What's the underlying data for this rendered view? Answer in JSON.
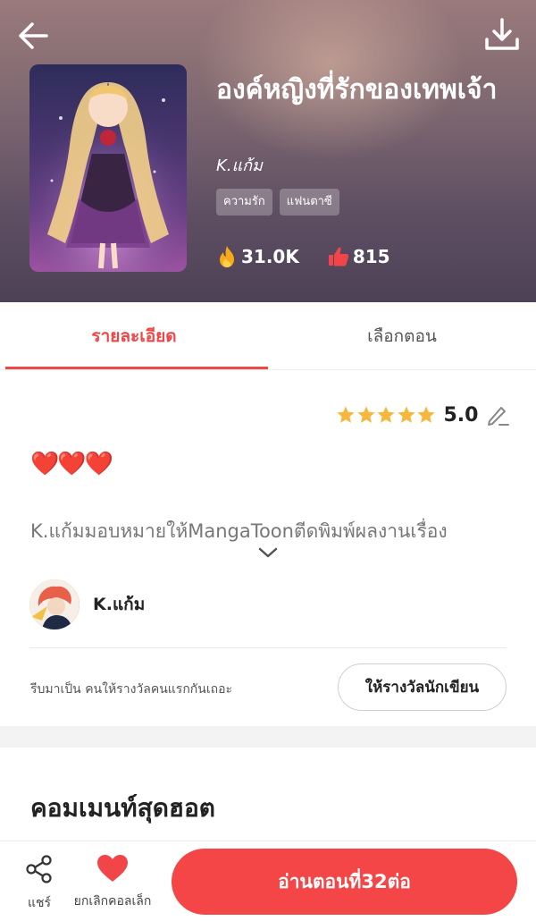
{
  "header": {
    "title": "องค์หญิงที่รักของเทพเจ้า",
    "author": "K.แก้ม",
    "tags": [
      "ความรัก",
      "แฟนตาซี"
    ],
    "views": "31.0K",
    "likes": "815"
  },
  "tabs": [
    {
      "label": "รายละเอียด",
      "active": true
    },
    {
      "label": "เลือกตอน",
      "active": false
    }
  ],
  "rating": {
    "stars": 5,
    "value": "5.0"
  },
  "description": {
    "emoji": "❤️❤️❤️",
    "text": "K.แก้มมอบหมายให้MangaToonตีดพิมพ์ผลงานเรื่อง"
  },
  "author_row": {
    "name": "K.แก้ม"
  },
  "reward": {
    "hint": "รีบมาเป็น คนให้รางวัลคนแรกกันเถอะ",
    "button": "ให้รางวัลนักเขียน"
  },
  "comments": {
    "title": "คอมเมนท์สุดฮอต"
  },
  "bottom_bar": {
    "share_label": "แชร์",
    "favorite_label": "ยกเลิกคอลเล็ก",
    "read_button": "อ่านตอนที่32ต่อ"
  },
  "colors": {
    "accent": "#f44547",
    "star": "#f5b83d"
  }
}
